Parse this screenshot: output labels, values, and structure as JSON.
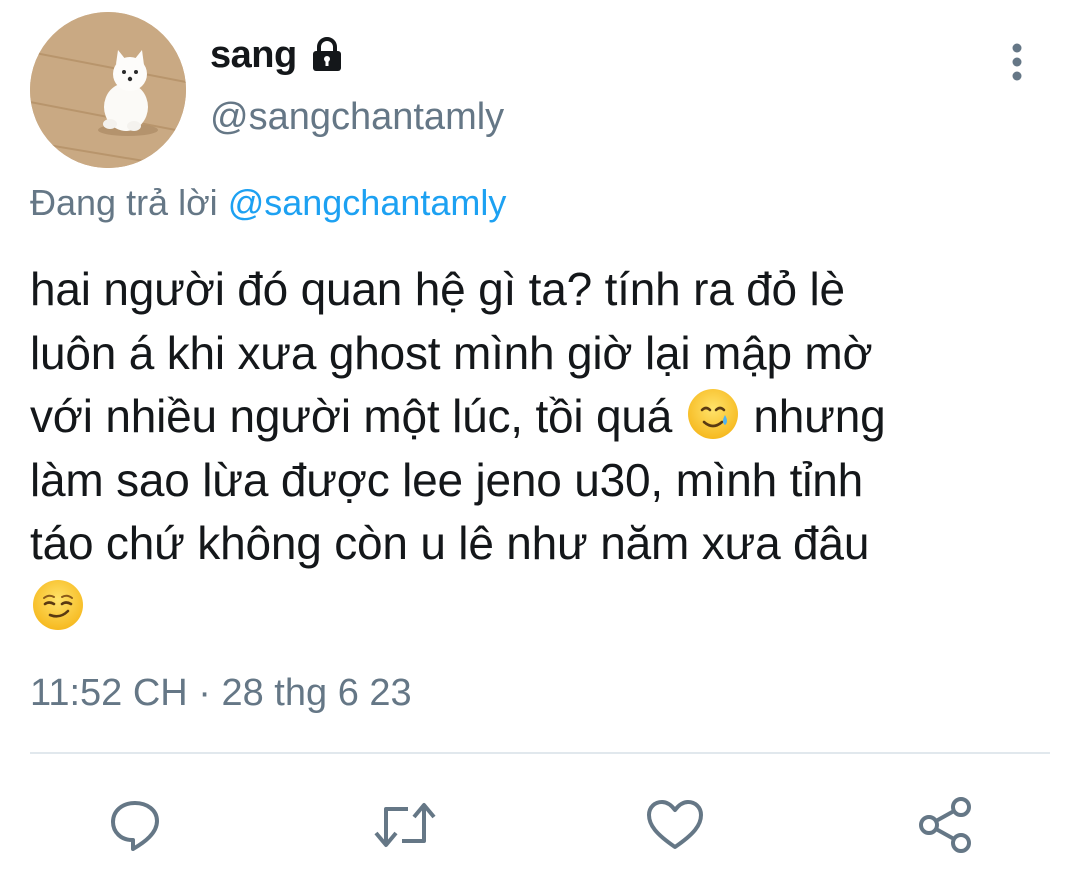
{
  "user": {
    "display_name": "sang",
    "handle": "@sangchantamly",
    "protected_icon": "lock-icon",
    "avatar": "white-puppy-avatar"
  },
  "reply": {
    "prefix": "Đang trả lời ",
    "mention": "@sangchantamly"
  },
  "tweet": {
    "line1": "hai người đó quan hệ gì ta? tính ra đỏ lè",
    "line2": "luôn á khi xưa ghost mình giờ lại mập mờ",
    "line3_before": "với nhiều người một lúc, tồi quá ",
    "line3_emoji": "smiling-face-with-tear-emoji",
    "line3_after": " nhưng",
    "line4": "làm sao lừa được lee jeno u30, mình tỉnh",
    "line5": "táo chứ không còn u lê như năm xưa đâu",
    "line6_emoji": "smirking-face-emoji"
  },
  "timestamp": "11:52 CH · 28 thg 6 23",
  "actions": {
    "reply_icon": "reply-icon",
    "retweet_icon": "retweet-icon",
    "like_icon": "heart-icon",
    "share_icon": "share-icon"
  },
  "colors": {
    "text": "#14171a",
    "secondary": "#657786",
    "link": "#1da1f2",
    "divider": "#e1e8ed"
  }
}
